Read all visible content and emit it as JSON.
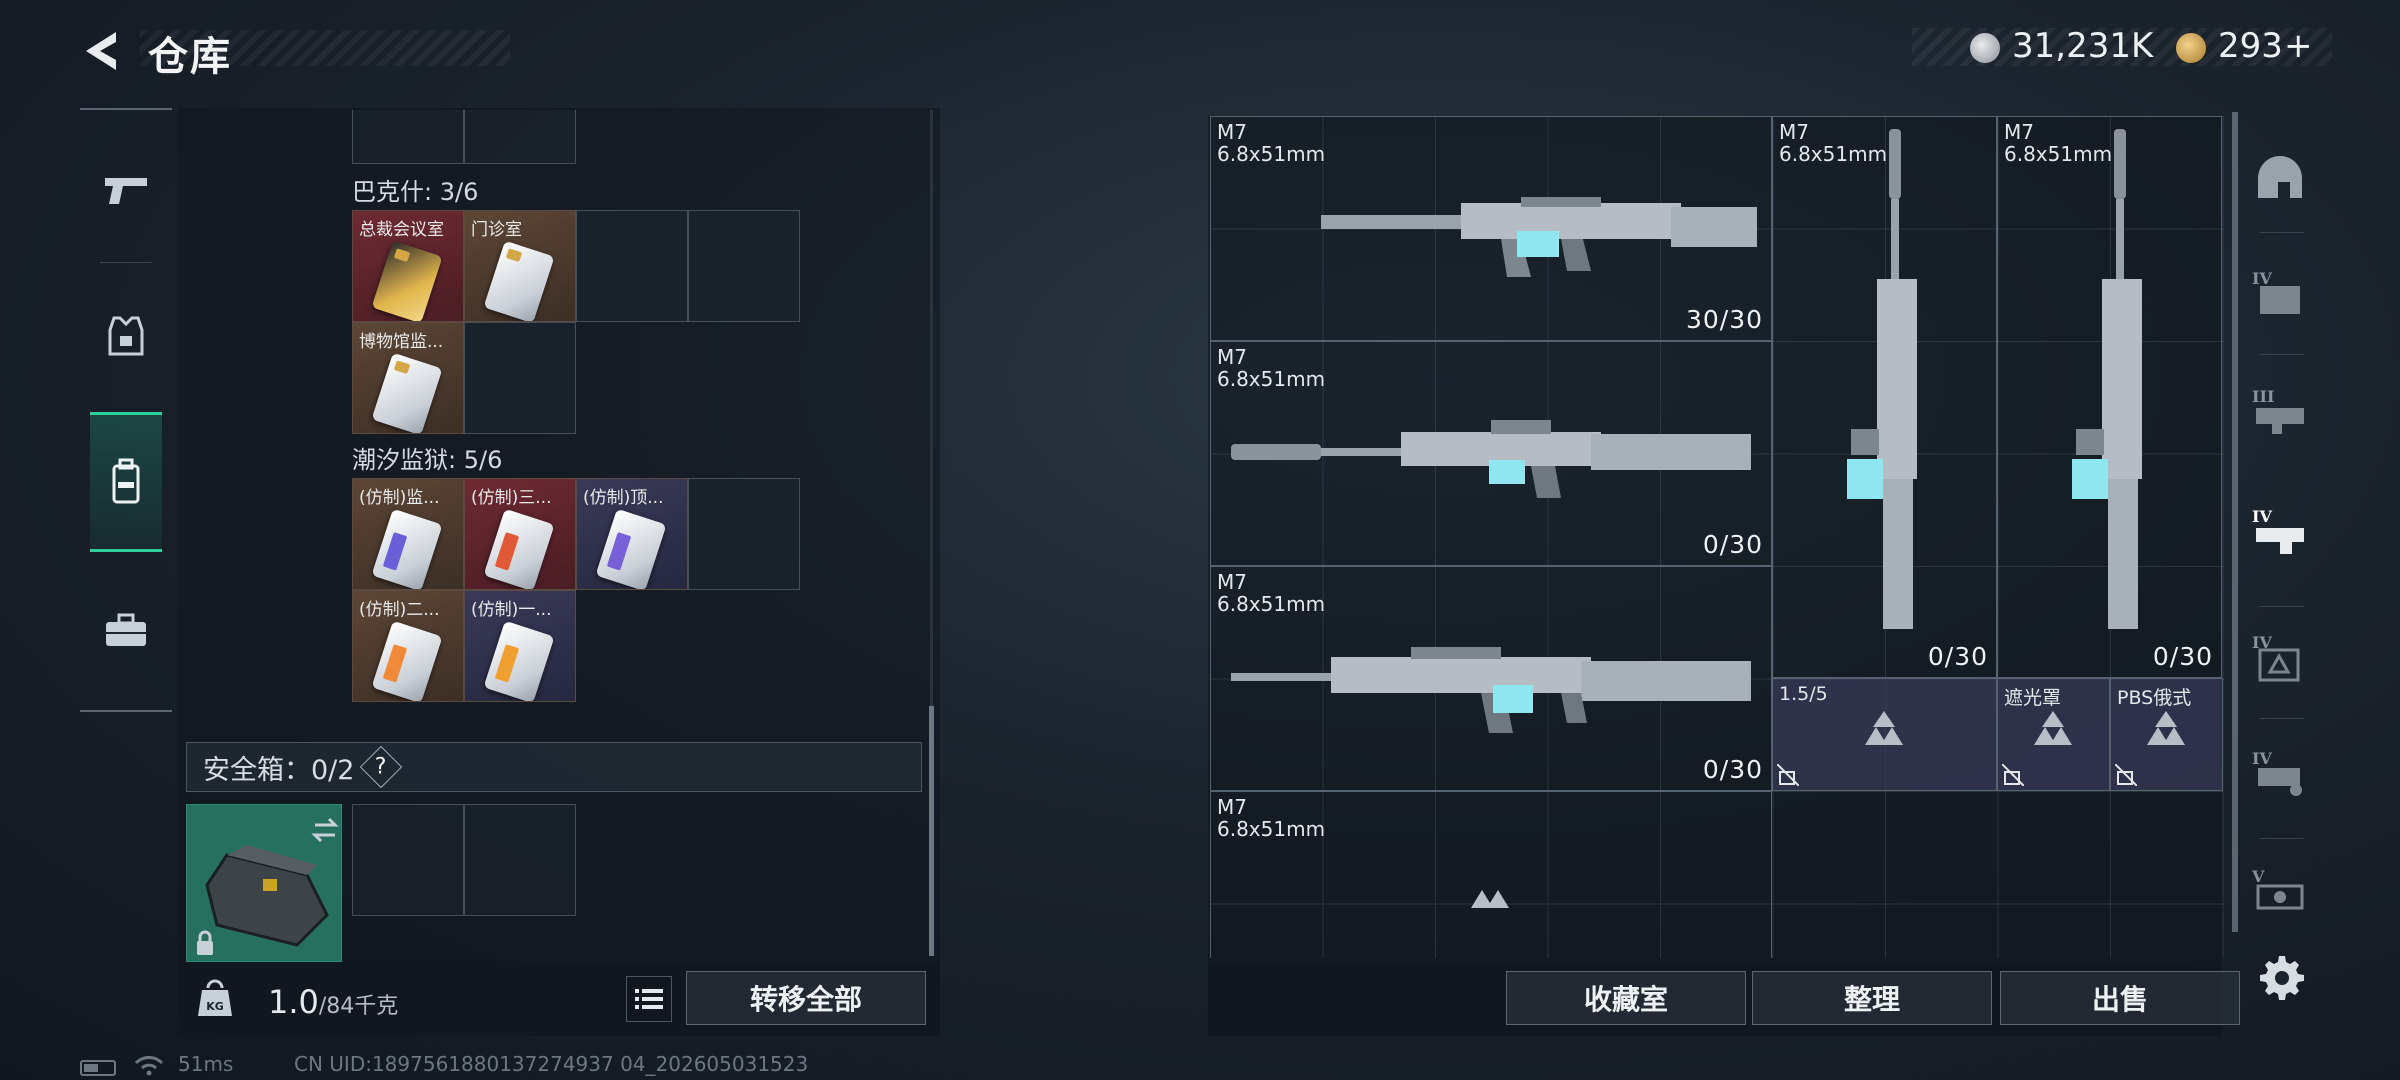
{
  "header": {
    "title": "仓库",
    "currency_silver": "31,231K",
    "currency_gold": "293",
    "add_symbol": "+"
  },
  "left_nav": {
    "items": [
      "weapon-tab",
      "armor-tab",
      "backpack-tab",
      "toolbox-tab"
    ],
    "active": "backpack-tab"
  },
  "keys": {
    "section_bakshi": "巴克什: 3/6",
    "section_tide_prison": "潮汐监狱: 5/6",
    "bakshi_cards": [
      {
        "label": "总裁会议室",
        "color": "red",
        "card": "gold"
      },
      {
        "label": "门诊室",
        "color": "brown",
        "card": "white"
      },
      {
        "label": "博物馆监...",
        "color": "brown",
        "card": "white"
      }
    ],
    "tide_cards": [
      {
        "label": "(仿制)监...",
        "color": "brown",
        "stripe": "#6b5ed9"
      },
      {
        "label": "(仿制)三...",
        "color": "red",
        "stripe": "#e05a3a"
      },
      {
        "label": "(仿制)顶...",
        "color": "navy",
        "stripe": "#7860d8"
      },
      {
        "label": "(仿制)二...",
        "color": "brown",
        "stripe": "#f08a3a"
      },
      {
        "label": "(仿制)一...",
        "color": "navy",
        "stripe": "#f0a030"
      }
    ]
  },
  "safebox": {
    "label": "安全箱：0/2",
    "help": "?"
  },
  "bottom_left": {
    "weight_value": "1.0",
    "weight_unit": "/84千克",
    "transfer_all": "转移全部"
  },
  "status": {
    "ping": "51ms",
    "uid": "CN UID:1897561880137274937 04_202605031523"
  },
  "weapons": [
    {
      "name": "M7",
      "caliber": "6.8x51mm",
      "ammo": "30/30"
    },
    {
      "name": "M7",
      "caliber": "6.8x51mm",
      "ammo": "0/30"
    },
    {
      "name": "M7",
      "caliber": "6.8x51mm",
      "ammo": "0/30"
    },
    {
      "name": "M7",
      "caliber": "6.8x51mm",
      "ammo": ""
    },
    {
      "name": "M7",
      "caliber": "6.8x51mm",
      "ammo": "0/30"
    },
    {
      "name": "M7",
      "caliber": "6.8x51mm",
      "ammo": "0/30"
    }
  ],
  "attachments": [
    {
      "label": "1.5/5"
    },
    {
      "label": "遮光罩"
    },
    {
      "label": "PBS俄式"
    }
  ],
  "actions": {
    "collection": "收藏室",
    "sort": "整理",
    "sell": "出售"
  },
  "filter_nav": {
    "tiers": [
      "IV",
      "III",
      "IV",
      "IV",
      "IV",
      "V"
    ]
  },
  "colors": {
    "accent": "#2fcf9b",
    "panel": "#10161d",
    "attachment_bg": "#3a3c5a"
  }
}
